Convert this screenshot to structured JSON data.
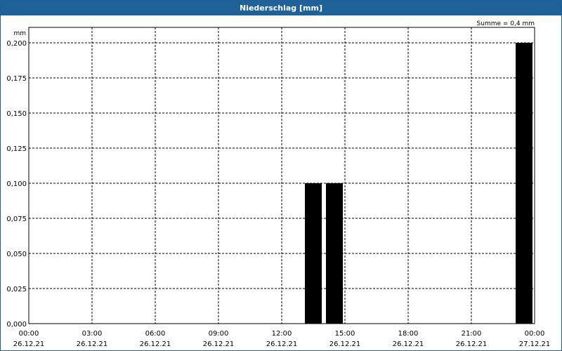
{
  "window": {
    "title": "Niederschlag [mm]"
  },
  "colors": {
    "titlebar": "#1e6299",
    "bars": "#000000",
    "grid": "#000000"
  },
  "chart_data": {
    "type": "bar",
    "title": "Niederschlag [mm]",
    "ylabel": "mm",
    "annotation": "Summe = 0,4 mm",
    "ylim": [
      0,
      0.2
    ],
    "yticks": [
      "0,000",
      "0,025",
      "0,050",
      "0,075",
      "0,100",
      "0,125",
      "0,150",
      "0,175",
      "0,200"
    ],
    "xticks": [
      {
        "time": "00:00",
        "date": "26.12.21"
      },
      {
        "time": "03:00",
        "date": "26.12.21"
      },
      {
        "time": "06:00",
        "date": "26.12.21"
      },
      {
        "time": "09:00",
        "date": "26.12.21"
      },
      {
        "time": "12:00",
        "date": "26.12.21"
      },
      {
        "time": "15:00",
        "date": "26.12.21"
      },
      {
        "time": "18:00",
        "date": "26.12.21"
      },
      {
        "time": "21:00",
        "date": "26.12.21"
      },
      {
        "time": "00:00",
        "date": "27.12.21"
      }
    ],
    "bars": [
      {
        "start": "26.12.21 13:00",
        "end": "26.12.21 14:00",
        "value": 0.1
      },
      {
        "start": "26.12.21 14:00",
        "end": "26.12.21 15:00",
        "value": 0.1
      },
      {
        "start": "26.12.21 23:00",
        "end": "27.12.21 00:00",
        "value": 0.2
      }
    ],
    "grid": true,
    "legend": "none"
  }
}
